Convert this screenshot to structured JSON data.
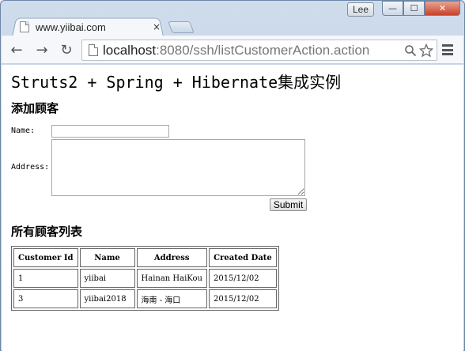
{
  "browser": {
    "tab_title": "www.yiibai.com",
    "tab_close": "×",
    "profile_name": "Lee",
    "window_buttons": {
      "minimize": "—",
      "maximize": "☐",
      "close": "✕"
    },
    "nav": {
      "back": "←",
      "forward": "→",
      "reload": "↻"
    },
    "url_host": "localhost",
    "url_rest": ":8080/ssh/listCustomerAction.action",
    "icons": [
      "page-icon",
      "search-icon",
      "star-icon",
      "menu-icon"
    ]
  },
  "page": {
    "title": "Struts2 + Spring + Hibernate集成实例",
    "add_heading": "添加顾客",
    "form": {
      "name_label": "Name:",
      "name_value": "",
      "address_label": "Address:",
      "address_value": "",
      "submit_label": "Submit"
    },
    "list_heading": "所有顾客列表",
    "table": {
      "headers": [
        "Customer Id",
        "Name",
        "Address",
        "Created Date"
      ],
      "rows": [
        [
          "1",
          "yiibai",
          "Hainan HaiKou",
          "2015/12/02"
        ],
        [
          "3",
          "yiibai2018",
          "海南 - 海口",
          "2015/12/02"
        ]
      ]
    }
  }
}
